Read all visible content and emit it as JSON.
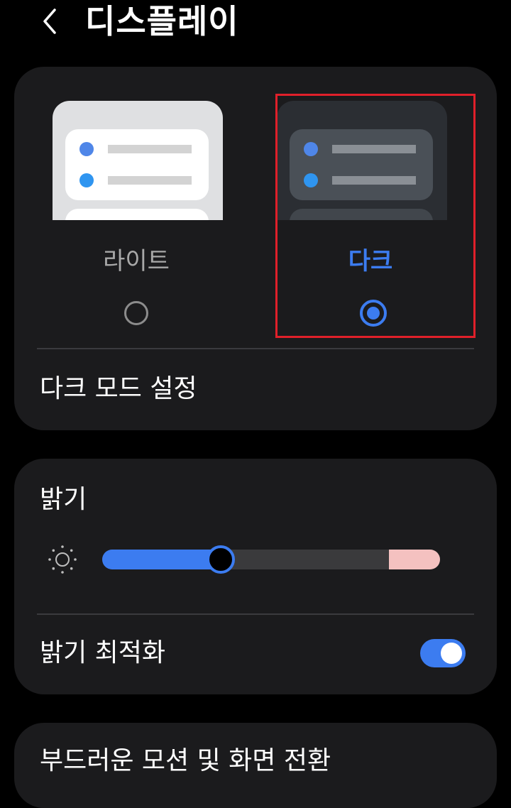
{
  "header": {
    "title": "디스플레이",
    "back_icon": "chevron-left-icon"
  },
  "theme": {
    "selected": "dark",
    "options": [
      {
        "id": "light",
        "label": "라이트",
        "selected": false
      },
      {
        "id": "dark",
        "label": "다크",
        "selected": true
      }
    ],
    "dark_mode_settings_label": "다크 모드 설정"
  },
  "brightness": {
    "label": "밝기",
    "icon": "sun-icon",
    "level_fraction": 0.35,
    "adaptive_label": "밝기 최적화",
    "adaptive_on": true
  },
  "motion": {
    "label": "부드러운 모션 및 화면 전환"
  },
  "colors": {
    "accent": "#3c7cf0",
    "card": "#1b1b1d",
    "background": "#000000",
    "highlight": "#e0202a",
    "slider_hot": "#f4c1c0"
  }
}
